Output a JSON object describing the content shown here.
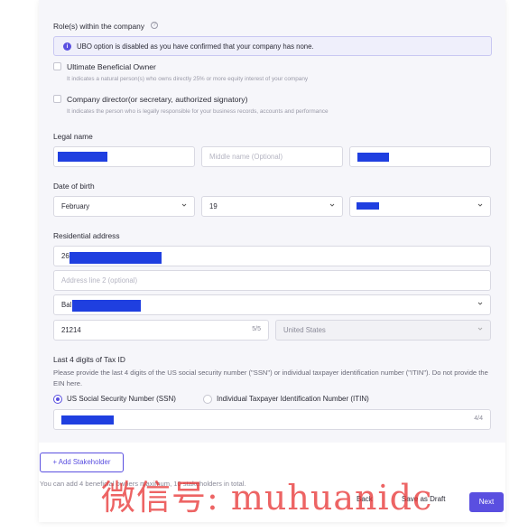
{
  "roles": {
    "title": "Role(s) within the company",
    "banner_text": "UBO option is disabled as you have confirmed that your company has none.",
    "ubo_label": "Ultimate Beneficial Owner",
    "ubo_hint": "It indicates a natural person(s) who owns directly 25% or more equity interest of your company",
    "director_label": "Company director(or secretary, authorized signatory)",
    "director_hint": "It indicates the person who is legally responsible for your business records, accounts and performance"
  },
  "legal_name": {
    "title": "Legal name",
    "middle_placeholder": "Middle name (Optional)"
  },
  "dob": {
    "title": "Date of birth",
    "month": "February",
    "day": "19"
  },
  "address": {
    "title": "Residential address",
    "line1_prefix": "26",
    "line2_placeholder": "Address line 2 (optional)",
    "city_prefix": "Bal",
    "zip": "21214",
    "zip_counter": "5/5",
    "country": "United States"
  },
  "tax": {
    "title": "Last 4 digits of Tax ID",
    "description": "Please provide the last 4 digits of the US social security number (\"SSN\") or individual taxpayer identification number (\"ITIN\"). Do not provide the EIN here.",
    "option_ssn": "US Social Security Number (SSN)",
    "option_itin": "Individual Taxpayer Identification Number (ITIN)",
    "counter": "4/4"
  },
  "footer": {
    "add_label": "+ Add Stakeholder",
    "note": "You can add 4 beneficial owners maximum, 10 stakeholders in total.",
    "back_label": "Back",
    "draft_label": "Save as Draft",
    "next_label": "Next"
  },
  "watermark": "微信号: muhuanidc",
  "colors": {
    "accent": "#5a4fe0",
    "redaction": "#1f3fe0"
  }
}
